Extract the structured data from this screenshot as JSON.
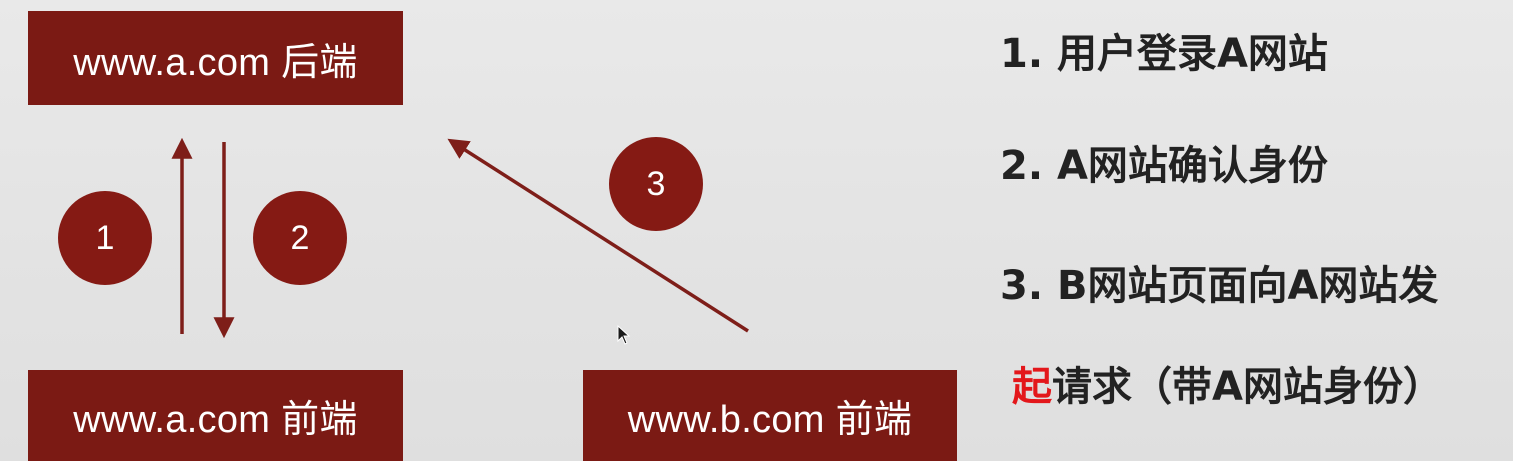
{
  "colors": {
    "box_fill": "#7b1a14",
    "arrow": "#7e1e19",
    "circle_fill": "#851a14",
    "text": "#222222",
    "highlight": "#e3171b"
  },
  "boxes": {
    "a_backend": "www.a.com 后端",
    "a_frontend": "www.a.com 前端",
    "b_frontend": "www.b.com 前端"
  },
  "steps": {
    "s1": "1",
    "s2": "2",
    "s3": "3"
  },
  "description": {
    "line1": "1. 用户登录A网站",
    "line2": "2. A网站确认身份",
    "line3": "3. B网站页面向A网站发",
    "line4_highlight": "起",
    "line4_rest": "请求（带A网站身份）"
  },
  "icons": {
    "cursor": "mouse-pointer-icon"
  }
}
